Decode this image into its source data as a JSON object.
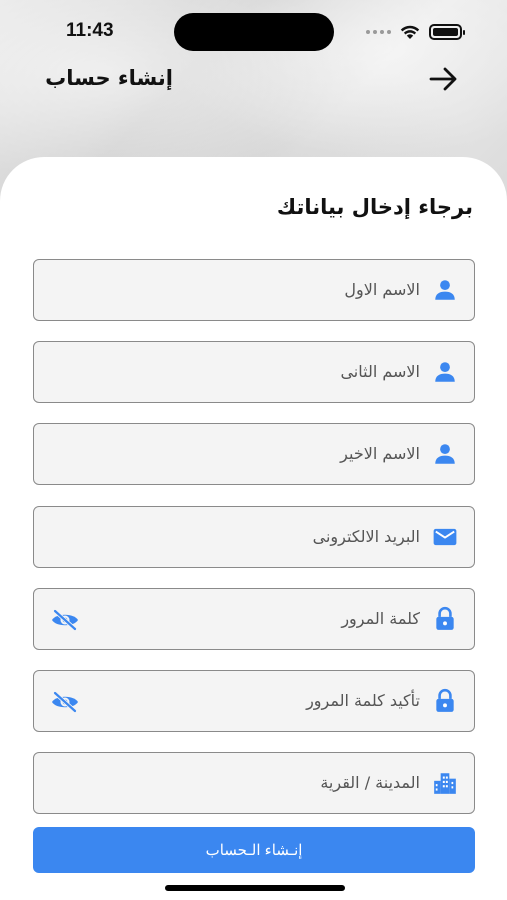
{
  "status_bar": {
    "time": "11:43"
  },
  "header": {
    "title": "إنشاء حساب"
  },
  "form": {
    "title": "برجاء إدخال بياناتك",
    "fields": [
      {
        "placeholder": "الاسم الاول",
        "icon": "person-icon"
      },
      {
        "placeholder": "الاسم الثانى",
        "icon": "person-icon"
      },
      {
        "placeholder": "الاسم الاخير",
        "icon": "person-icon"
      },
      {
        "placeholder": "البريد الالكترونى",
        "icon": "mail-icon"
      },
      {
        "placeholder": "كلمة المرور",
        "icon": "lock-icon",
        "toggle": "eye-off-icon"
      },
      {
        "placeholder": "تأكيد كلمة المرور",
        "icon": "lock-icon",
        "toggle": "eye-off-icon"
      },
      {
        "placeholder": "المدينة / القرية",
        "icon": "city-icon"
      }
    ],
    "submit_label": "إنـشاء الـحساب"
  },
  "colors": {
    "accent": "#3b87f0",
    "text": "#111111",
    "field_bg": "#f4f4f4"
  }
}
